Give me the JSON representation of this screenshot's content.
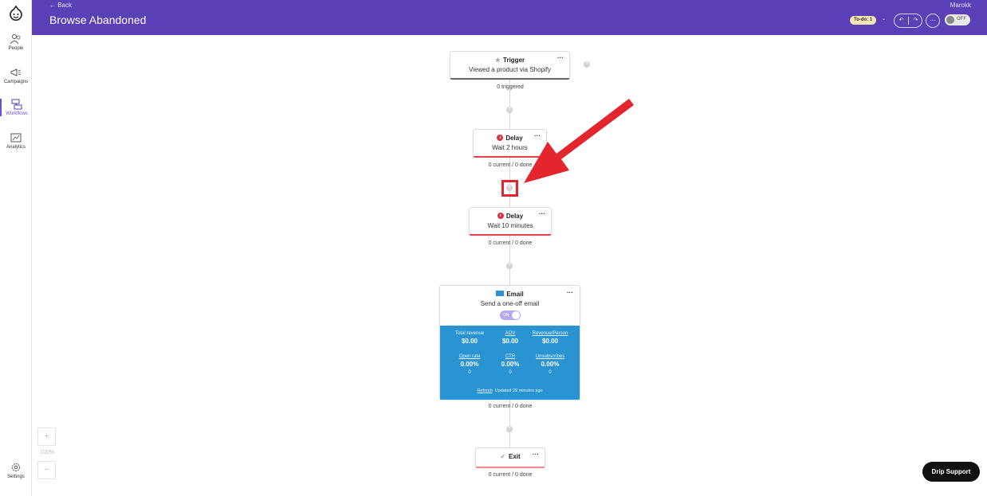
{
  "header": {
    "back_label": "← Back",
    "title": "Browse Abandoned",
    "account_name": "Marokk",
    "todo_badge": "To-do: 1",
    "todo_caret": "⌄",
    "undo_icon": "↶",
    "redo_icon": "↷",
    "more_icon": "···",
    "workflow_toggle": "OFF"
  },
  "sidebar": {
    "items": [
      {
        "label": "People",
        "icon": "people-icon"
      },
      {
        "label": "Campaigns",
        "icon": "megaphone-icon"
      },
      {
        "label": "Workflows",
        "icon": "workflow-icon"
      },
      {
        "label": "Analytics",
        "icon": "analytics-icon"
      },
      {
        "label": "Settings",
        "icon": "gear-icon"
      }
    ]
  },
  "workflow": {
    "trigger": {
      "title": "Trigger",
      "subtitle": "Viewed a product via Shopify",
      "stats": "0 triggered",
      "menu": "···"
    },
    "delay1": {
      "title": "Delay",
      "subtitle": "Wait 2 hours",
      "stats": "0 current / 0 done",
      "menu": "···"
    },
    "delay2": {
      "title": "Delay",
      "subtitle": "Wait 10 minutes",
      "stats": "0 current / 0 done",
      "menu": "···"
    },
    "email": {
      "title": "Email",
      "subtitle": "Send a one-off email",
      "toggle": "ON",
      "menu": "···",
      "metrics": [
        {
          "label": "Total revenue",
          "value": "$0.00",
          "count": ""
        },
        {
          "label": "AOV",
          "value": "$0.00",
          "count": ""
        },
        {
          "label": "Revenue/Person",
          "value": "$0.00",
          "count": ""
        },
        {
          "label": "Open rate",
          "value": "0.00%",
          "count": "0"
        },
        {
          "label": "CTR",
          "value": "0.00%",
          "count": "0"
        },
        {
          "label": "Unsubscribes",
          "value": "0.00%",
          "count": "0"
        }
      ],
      "refresh_label": "Refresh",
      "updated_text": "Updated 29 minutes ago",
      "stats": "0 current / 0 done"
    },
    "exit": {
      "title": "Exit",
      "stats": "0 current / 0 done",
      "menu": "···"
    }
  },
  "zoom": {
    "plus": "+",
    "minus": "−",
    "level": "100%"
  },
  "support_label": "Drip Support",
  "colors": {
    "header_bg": "#5a3fb6",
    "delay_accent": "#e4424f",
    "email_panel": "#2a93d2",
    "highlight": "#e3262e",
    "arrow": "#e3262e"
  }
}
